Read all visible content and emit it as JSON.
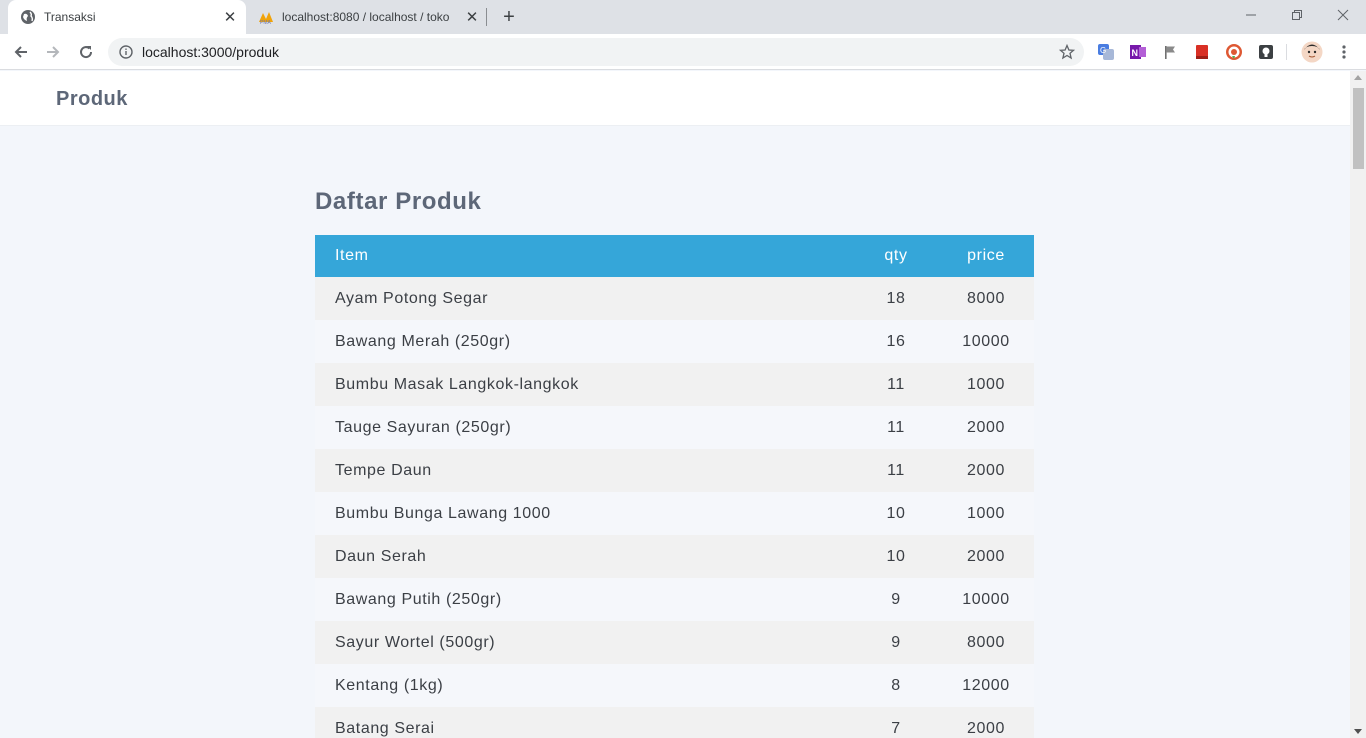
{
  "browser": {
    "tabs": [
      {
        "title": "Transaksi",
        "icon": "globe-icon",
        "active": true
      },
      {
        "title": "localhost:8080 / localhost / toko",
        "icon": "phpmyadmin-icon",
        "active": false
      }
    ],
    "new_tab_label": "+",
    "address": "localhost:3000/produk",
    "extensions": [
      "translate-icon",
      "onenote-icon",
      "flag-icon",
      "bookmark-red-icon",
      "duckduckgo-icon",
      "lightbulb-icon",
      "profile-avatar"
    ]
  },
  "app": {
    "brand": "Produk"
  },
  "page": {
    "heading": "Daftar Produk",
    "columns": {
      "item": "Item",
      "qty": "qty",
      "price": "price"
    },
    "rows": [
      {
        "item": "Ayam Potong Segar",
        "qty": "18",
        "price": "8000"
      },
      {
        "item": "Bawang Merah (250gr)",
        "qty": "16",
        "price": "10000"
      },
      {
        "item": "Bumbu Masak Langkok-langkok",
        "qty": "11",
        "price": "1000"
      },
      {
        "item": "Tauge Sayuran (250gr)",
        "qty": "11",
        "price": "2000"
      },
      {
        "item": "Tempe Daun",
        "qty": "11",
        "price": "2000"
      },
      {
        "item": "Bumbu Bunga Lawang 1000",
        "qty": "10",
        "price": "1000"
      },
      {
        "item": "Daun Serah",
        "qty": "10",
        "price": "2000"
      },
      {
        "item": "Bawang Putih (250gr)",
        "qty": "9",
        "price": "10000"
      },
      {
        "item": "Sayur Wortel (500gr)",
        "qty": "9",
        "price": "8000"
      },
      {
        "item": "Kentang (1kg)",
        "qty": "8",
        "price": "12000"
      },
      {
        "item": "Batang Serai",
        "qty": "7",
        "price": "2000"
      }
    ]
  },
  "colors": {
    "table_header": "#35a6d9",
    "heading_text": "#5d6778",
    "page_background": "#f3f6fb"
  }
}
